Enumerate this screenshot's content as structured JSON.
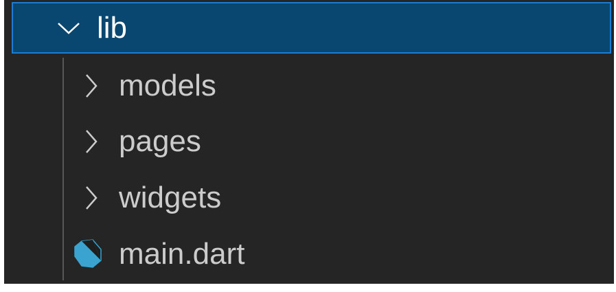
{
  "tree": {
    "root": {
      "label": "lib",
      "icon": "chevron-down-icon",
      "expanded": true
    },
    "items": [
      {
        "label": "models",
        "icon": "chevron-right-icon",
        "type": "folder"
      },
      {
        "label": "pages",
        "icon": "chevron-right-icon",
        "type": "folder"
      },
      {
        "label": "widgets",
        "icon": "chevron-right-icon",
        "type": "folder"
      },
      {
        "label": "main.dart",
        "icon": "dart-file-icon",
        "type": "file"
      }
    ]
  },
  "colors": {
    "selection": "#094771",
    "background": "#252526",
    "dart": "#3aa3cf"
  }
}
